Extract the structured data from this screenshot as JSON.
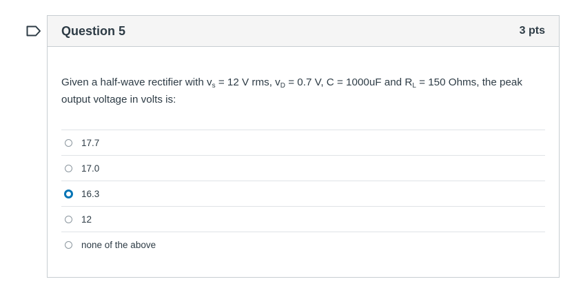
{
  "question": {
    "title": "Question 5",
    "points": "3 pts",
    "text": {
      "part1": "Given a half-wave rectifier with v",
      "sub_s": "s",
      "part2": " = 12 V rms, v",
      "sub_D": "D",
      "part3": " = 0.7 V, C = 1000uF and R",
      "sub_L": "L",
      "part4": " = 150 Ohms, the peak output voltage in volts is:"
    },
    "answers": [
      {
        "label": "17.7",
        "selected": false
      },
      {
        "label": "17.0",
        "selected": false
      },
      {
        "label": "16.3",
        "selected": true
      },
      {
        "label": "12",
        "selected": false
      },
      {
        "label": "none of the above",
        "selected": false
      }
    ]
  },
  "icons": {
    "flag": "flag-outline-icon",
    "radio_selected": "radio-selected-icon",
    "radio_unselected": "radio-unselected-icon"
  },
  "colors": {
    "text": "#2d3b45",
    "accent": "#0374b5",
    "header_bg": "#f5f5f5",
    "border": "#c7cdd1"
  }
}
